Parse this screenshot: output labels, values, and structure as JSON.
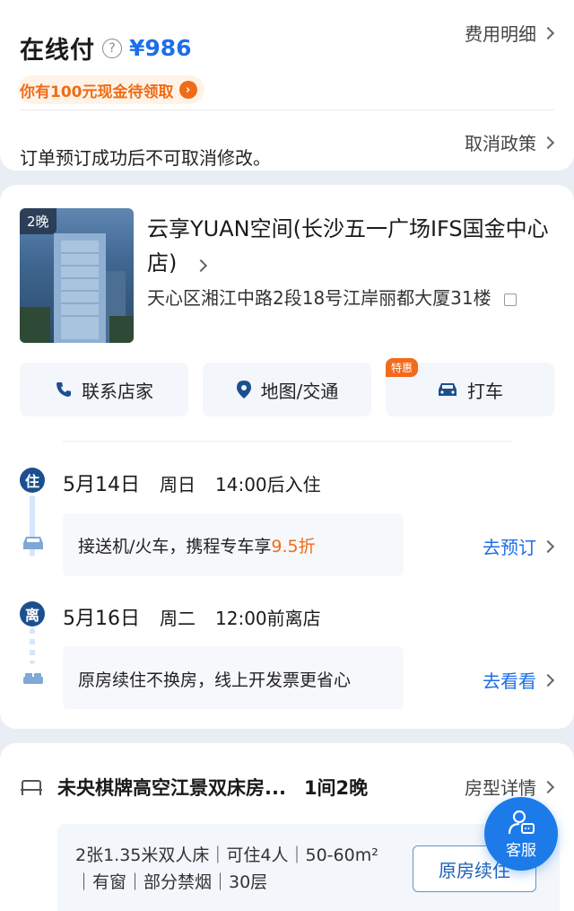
{
  "payment": {
    "title": "在线付",
    "price": "¥986",
    "detail_link": "费用明细",
    "cash_badge": "你有100元现金待领取",
    "cancel_note": "订单预订成功后不可取消修改。",
    "cancel_policy_link": "取消政策"
  },
  "hotel": {
    "nights_tag": "2晚",
    "name": "云享YUAN空间(长沙五一广场IFS国金中心店)",
    "address": "天心区湘江中路2段18号江岸丽都大厦31楼"
  },
  "actions": {
    "contact": "联系店家",
    "map": "地图/交通",
    "taxi": "打车",
    "taxi_promo": "特惠"
  },
  "stay": {
    "checkin_badge": "住",
    "checkin_date": "5月14日",
    "checkin_weekday": "周日",
    "checkin_time": "14:00后入住",
    "transfer_text": "接送机/火车，携程专车享",
    "transfer_discount": "9.5折",
    "transfer_link": "去预订",
    "checkout_badge": "离",
    "checkout_date": "5月16日",
    "checkout_weekday": "周二",
    "checkout_time": "12:00前离店",
    "extend_text": "原房续住不换房，线上开发票更省心",
    "extend_link": "去看看"
  },
  "room": {
    "title": "未央棋牌高空江景双床房...",
    "count": "1间2晚",
    "detail_link": "房型详情",
    "spec": "2张1.35米双人床｜可住4人｜50-60m²｜有窗｜部分禁烟｜30层",
    "renew_button": "原房续住"
  },
  "service_fab": {
    "label": "客服"
  },
  "colors": {
    "accent": "#1c6fe8",
    "promo": "#ef6c16",
    "badge": "#1c4f8f"
  }
}
